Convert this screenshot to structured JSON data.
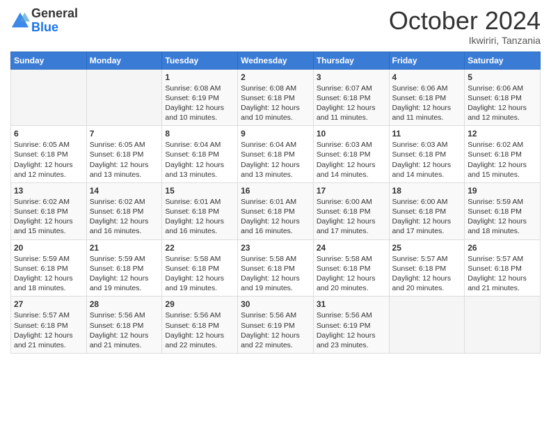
{
  "logo": {
    "general": "General",
    "blue": "Blue"
  },
  "header": {
    "month": "October 2024",
    "location": "Ikwiriri, Tanzania"
  },
  "weekdays": [
    "Sunday",
    "Monday",
    "Tuesday",
    "Wednesday",
    "Thursday",
    "Friday",
    "Saturday"
  ],
  "weeks": [
    [
      {
        "day": null,
        "info": null
      },
      {
        "day": null,
        "info": null
      },
      {
        "day": "1",
        "info": "Sunrise: 6:08 AM\nSunset: 6:19 PM\nDaylight: 12 hours and 10 minutes."
      },
      {
        "day": "2",
        "info": "Sunrise: 6:08 AM\nSunset: 6:18 PM\nDaylight: 12 hours and 10 minutes."
      },
      {
        "day": "3",
        "info": "Sunrise: 6:07 AM\nSunset: 6:18 PM\nDaylight: 12 hours and 11 minutes."
      },
      {
        "day": "4",
        "info": "Sunrise: 6:06 AM\nSunset: 6:18 PM\nDaylight: 12 hours and 11 minutes."
      },
      {
        "day": "5",
        "info": "Sunrise: 6:06 AM\nSunset: 6:18 PM\nDaylight: 12 hours and 12 minutes."
      }
    ],
    [
      {
        "day": "6",
        "info": "Sunrise: 6:05 AM\nSunset: 6:18 PM\nDaylight: 12 hours and 12 minutes."
      },
      {
        "day": "7",
        "info": "Sunrise: 6:05 AM\nSunset: 6:18 PM\nDaylight: 12 hours and 13 minutes."
      },
      {
        "day": "8",
        "info": "Sunrise: 6:04 AM\nSunset: 6:18 PM\nDaylight: 12 hours and 13 minutes."
      },
      {
        "day": "9",
        "info": "Sunrise: 6:04 AM\nSunset: 6:18 PM\nDaylight: 12 hours and 13 minutes."
      },
      {
        "day": "10",
        "info": "Sunrise: 6:03 AM\nSunset: 6:18 PM\nDaylight: 12 hours and 14 minutes."
      },
      {
        "day": "11",
        "info": "Sunrise: 6:03 AM\nSunset: 6:18 PM\nDaylight: 12 hours and 14 minutes."
      },
      {
        "day": "12",
        "info": "Sunrise: 6:02 AM\nSunset: 6:18 PM\nDaylight: 12 hours and 15 minutes."
      }
    ],
    [
      {
        "day": "13",
        "info": "Sunrise: 6:02 AM\nSunset: 6:18 PM\nDaylight: 12 hours and 15 minutes."
      },
      {
        "day": "14",
        "info": "Sunrise: 6:02 AM\nSunset: 6:18 PM\nDaylight: 12 hours and 16 minutes."
      },
      {
        "day": "15",
        "info": "Sunrise: 6:01 AM\nSunset: 6:18 PM\nDaylight: 12 hours and 16 minutes."
      },
      {
        "day": "16",
        "info": "Sunrise: 6:01 AM\nSunset: 6:18 PM\nDaylight: 12 hours and 16 minutes."
      },
      {
        "day": "17",
        "info": "Sunrise: 6:00 AM\nSunset: 6:18 PM\nDaylight: 12 hours and 17 minutes."
      },
      {
        "day": "18",
        "info": "Sunrise: 6:00 AM\nSunset: 6:18 PM\nDaylight: 12 hours and 17 minutes."
      },
      {
        "day": "19",
        "info": "Sunrise: 5:59 AM\nSunset: 6:18 PM\nDaylight: 12 hours and 18 minutes."
      }
    ],
    [
      {
        "day": "20",
        "info": "Sunrise: 5:59 AM\nSunset: 6:18 PM\nDaylight: 12 hours and 18 minutes."
      },
      {
        "day": "21",
        "info": "Sunrise: 5:59 AM\nSunset: 6:18 PM\nDaylight: 12 hours and 19 minutes."
      },
      {
        "day": "22",
        "info": "Sunrise: 5:58 AM\nSunset: 6:18 PM\nDaylight: 12 hours and 19 minutes."
      },
      {
        "day": "23",
        "info": "Sunrise: 5:58 AM\nSunset: 6:18 PM\nDaylight: 12 hours and 19 minutes."
      },
      {
        "day": "24",
        "info": "Sunrise: 5:58 AM\nSunset: 6:18 PM\nDaylight: 12 hours and 20 minutes."
      },
      {
        "day": "25",
        "info": "Sunrise: 5:57 AM\nSunset: 6:18 PM\nDaylight: 12 hours and 20 minutes."
      },
      {
        "day": "26",
        "info": "Sunrise: 5:57 AM\nSunset: 6:18 PM\nDaylight: 12 hours and 21 minutes."
      }
    ],
    [
      {
        "day": "27",
        "info": "Sunrise: 5:57 AM\nSunset: 6:18 PM\nDaylight: 12 hours and 21 minutes."
      },
      {
        "day": "28",
        "info": "Sunrise: 5:56 AM\nSunset: 6:18 PM\nDaylight: 12 hours and 21 minutes."
      },
      {
        "day": "29",
        "info": "Sunrise: 5:56 AM\nSunset: 6:18 PM\nDaylight: 12 hours and 22 minutes."
      },
      {
        "day": "30",
        "info": "Sunrise: 5:56 AM\nSunset: 6:19 PM\nDaylight: 12 hours and 22 minutes."
      },
      {
        "day": "31",
        "info": "Sunrise: 5:56 AM\nSunset: 6:19 PM\nDaylight: 12 hours and 23 minutes."
      },
      {
        "day": null,
        "info": null
      },
      {
        "day": null,
        "info": null
      }
    ]
  ]
}
